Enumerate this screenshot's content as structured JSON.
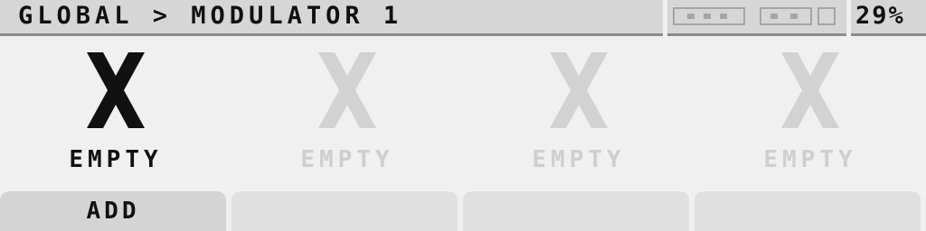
{
  "header": {
    "breadcrumb": "GLOBAL > MODULATOR 1",
    "battery": "29%"
  },
  "slots": [
    {
      "mark": "X",
      "label": "EMPTY",
      "active": true
    },
    {
      "mark": "X",
      "label": "EMPTY",
      "active": false
    },
    {
      "mark": "X",
      "label": "EMPTY",
      "active": false
    },
    {
      "mark": "X",
      "label": "EMPTY",
      "active": false
    }
  ],
  "softkeys": [
    {
      "label": "ADD"
    },
    {
      "label": ""
    },
    {
      "label": ""
    },
    {
      "label": ""
    }
  ],
  "colors": {
    "active_mark": "#111111",
    "inactive_mark": "#d2d2d2"
  },
  "icons": {
    "empty_slot": "x-mark-icon",
    "meter": "level-meter-icon"
  }
}
